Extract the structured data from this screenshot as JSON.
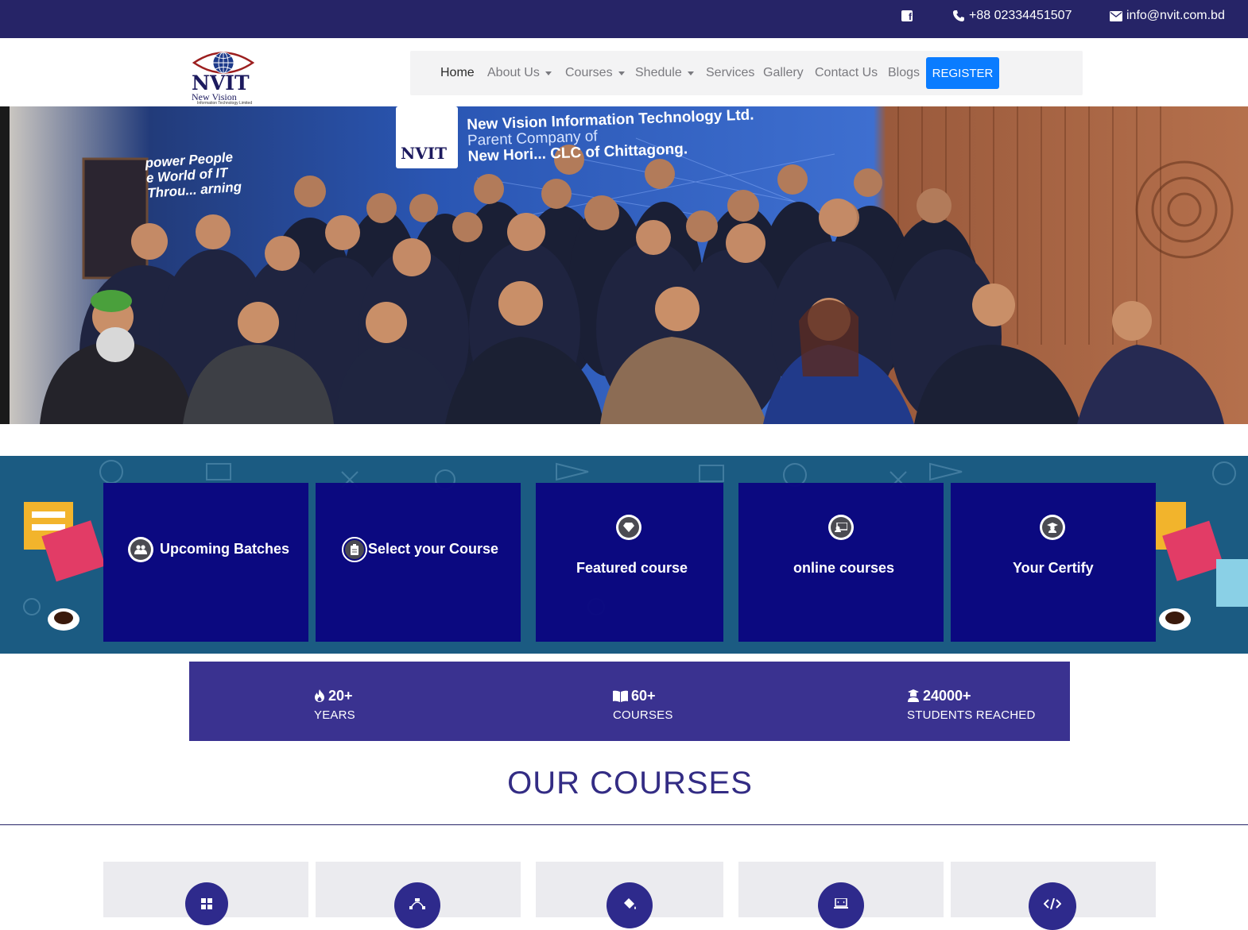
{
  "topbar": {
    "facebook_icon": "facebook-square-icon",
    "phone": "+88 02334451507",
    "email": "info@nvit.com.bd",
    "bg_color": "#262467"
  },
  "logo": {
    "brand": "NVIT",
    "subtitle": "New Vision",
    "tagline": "Information Technology Limited"
  },
  "nav": {
    "items": [
      {
        "label": "Home",
        "active": true,
        "dropdown": false
      },
      {
        "label": "About Us",
        "active": false,
        "dropdown": true
      },
      {
        "label": "Courses",
        "active": false,
        "dropdown": true
      },
      {
        "label": "Shedule",
        "active": false,
        "dropdown": true
      },
      {
        "label": "Services",
        "active": false,
        "dropdown": false
      },
      {
        "label": "Gallery",
        "active": false,
        "dropdown": false
      },
      {
        "label": "Contact Us",
        "active": false,
        "dropdown": false
      },
      {
        "label": "Blogs",
        "active": false,
        "dropdown": false
      }
    ],
    "register_label": "REGISTER",
    "register_color": "#0a7cff"
  },
  "hero": {
    "banner_line1": "New Vision Information Technology Ltd.",
    "banner_line2": "Parent Company of",
    "banner_line3": "New Hori... CLC of Chittagong.",
    "banner_logo": "NVIT",
    "left_line1": "power People",
    "left_line2": "e World of IT",
    "left_line3": "Throu... arning"
  },
  "features": {
    "cards": [
      {
        "label": "Upcoming Batches",
        "icon": "users-icon"
      },
      {
        "label": "Select your Course",
        "icon": "clipboard-icon"
      },
      {
        "label": "Featured course",
        "icon": "diamond-icon"
      },
      {
        "label": "online courses",
        "icon": "online-class-icon"
      },
      {
        "label": "Your Certify",
        "icon": "graduate-icon"
      }
    ],
    "card_color": "#0a0680"
  },
  "stats": {
    "items": [
      {
        "value": "20+",
        "label": "YEARS",
        "icon": "fire-icon"
      },
      {
        "value": "60+",
        "label": "COURSES",
        "icon": "book-open-icon"
      },
      {
        "value": "24000+",
        "label": "STUDENTS REACHED",
        "icon": "student-icon"
      }
    ],
    "bg_color": "#3a3290"
  },
  "courses": {
    "title": "OUR COURSES",
    "cards": [
      {
        "icon": "windows-icon"
      },
      {
        "icon": "vector-design-icon"
      },
      {
        "icon": "paint-bucket-icon"
      },
      {
        "icon": "laptop-code-icon"
      },
      {
        "icon": "code-icon"
      }
    ]
  }
}
